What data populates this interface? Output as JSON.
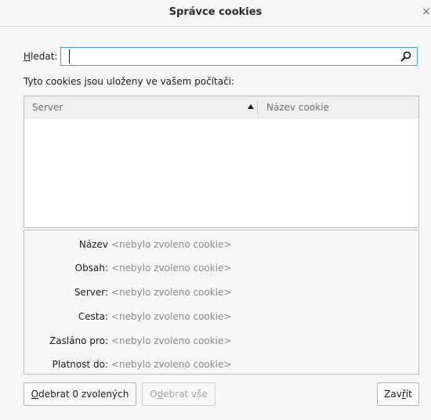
{
  "window": {
    "title": "Správce cookies",
    "close_glyph": "×"
  },
  "search": {
    "label_accesskey": "H",
    "label_rest": "ledat:",
    "value": "",
    "placeholder": "",
    "icon": "search-icon"
  },
  "stored_label": "Tyto cookies jsou uloženy ve vašem počítači:",
  "table": {
    "columns": [
      {
        "label": "Server",
        "sorted": "ascending",
        "icon": "sort-up-icon"
      },
      {
        "label": "Název cookie"
      }
    ],
    "rows": []
  },
  "details": [
    {
      "label": "Název",
      "value": "<nebylo zvoleno cookie>"
    },
    {
      "label": "Obsah:",
      "value": "<nebylo zvoleno cookie>"
    },
    {
      "label": "Server:",
      "value": "<nebylo zvoleno cookie>"
    },
    {
      "label": "Cesta:",
      "value": "<nebylo zvoleno cookie>"
    },
    {
      "label": "Zasláno pro:",
      "value": "<nebylo zvoleno cookie>"
    },
    {
      "label": "Platnost do:",
      "value": "<nebylo zvoleno cookie>"
    }
  ],
  "buttons": {
    "remove_selected": {
      "accesskey": "O",
      "rest": "debrat 0 zvolených",
      "enabled": true
    },
    "remove_all": {
      "pre": "O",
      "accesskey": "d",
      "rest": "ebrat vše",
      "enabled": false
    },
    "close": {
      "pre": "Zav",
      "accesskey": "ř",
      "rest": "ít",
      "enabled": true
    }
  },
  "colors": {
    "focus_border": "#3d9fd8",
    "disabled_text": "#a4a4a4",
    "placeholder_value": "#8a8a8a"
  }
}
